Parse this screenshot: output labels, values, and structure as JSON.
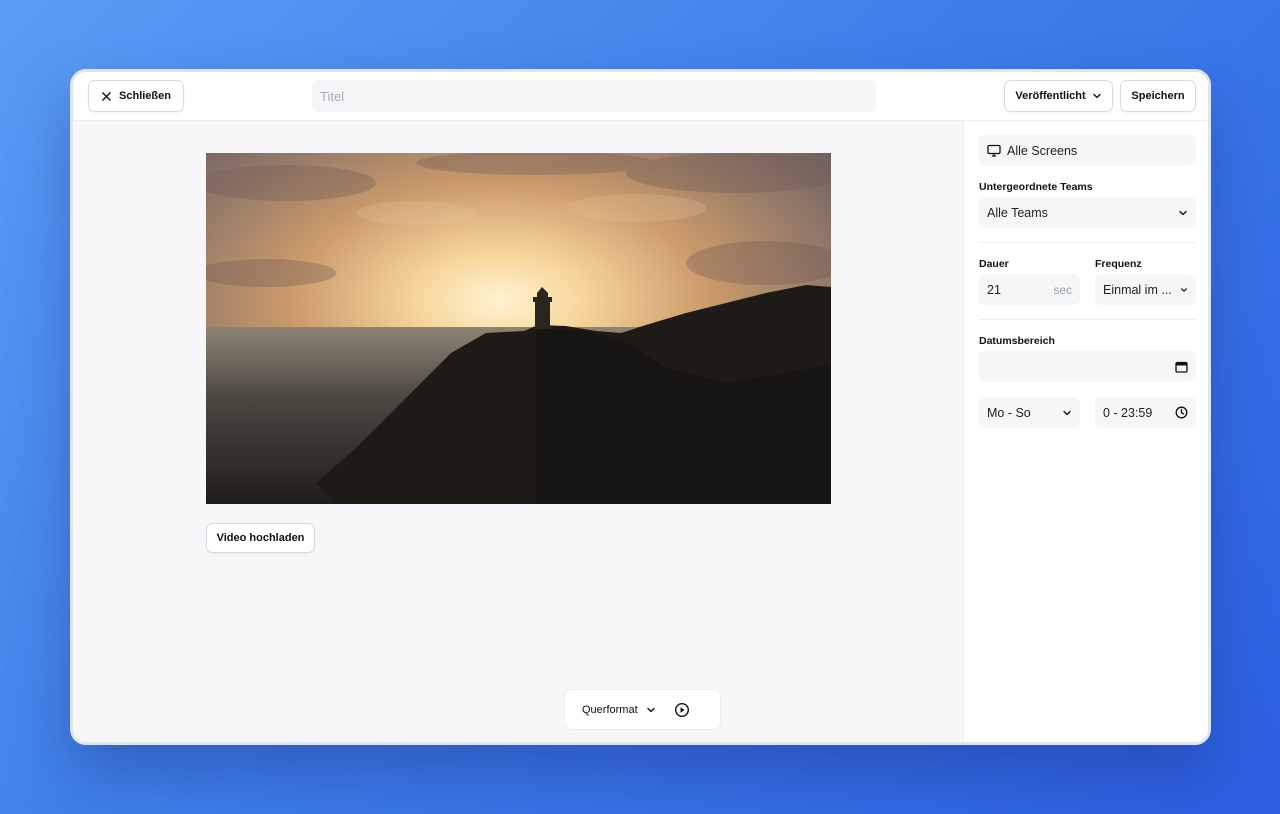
{
  "header": {
    "close_label": "Schließen",
    "title_placeholder": "Titel",
    "status_label": "Veröffentlicht",
    "save_label": "Speichern"
  },
  "canvas": {
    "upload_label": "Video hochladen",
    "orientation_label": "Querformat"
  },
  "sidebar": {
    "screens_label": "Alle Screens",
    "teams_label": "Untergeordnete Teams",
    "teams_value": "Alle Teams",
    "duration_label": "Dauer",
    "duration_value": "21",
    "duration_unit": "sec",
    "frequency_label": "Frequenz",
    "frequency_value": "Einmal im ...",
    "date_range_label": "Datumsbereich",
    "date_range_value": "",
    "weekdays_value": "Mo - So",
    "time_value": "0 - 23:59"
  },
  "icons": {
    "close": "close-icon",
    "status_dropdown": "chevron-down-icon",
    "screens": "monitor-icon",
    "calendar": "calendar-icon",
    "clock": "clock-icon",
    "play": "play-icon"
  },
  "colors": {
    "background_gradient_start": "#5a9df4",
    "background_gradient_end": "#2c5fe0",
    "field_bg": "#f5f6f8",
    "canvas_bg": "#f7f7f9"
  }
}
